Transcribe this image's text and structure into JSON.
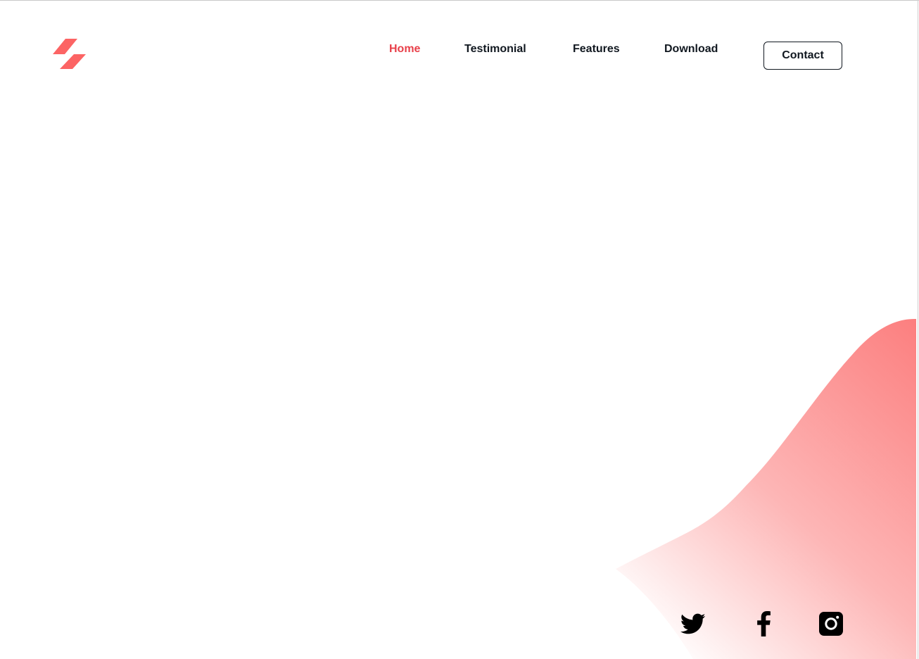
{
  "brand": {
    "logo_icon": "lightning-slash-logo",
    "accent": "#fc6464"
  },
  "nav": {
    "items": [
      {
        "label": "Home",
        "active": true
      },
      {
        "label": "Testimonial",
        "active": false
      },
      {
        "label": "Features",
        "active": false
      },
      {
        "label": "Download",
        "active": false
      }
    ],
    "active_color": "#e8404a",
    "text_color": "#111820"
  },
  "header": {
    "contact_label": "Contact"
  },
  "hero": {
    "wave_colors": [
      "#fc7f7f",
      "#ffffff"
    ]
  },
  "social": {
    "icons": [
      "twitter-icon",
      "facebook-icon",
      "instagram-icon"
    ]
  }
}
